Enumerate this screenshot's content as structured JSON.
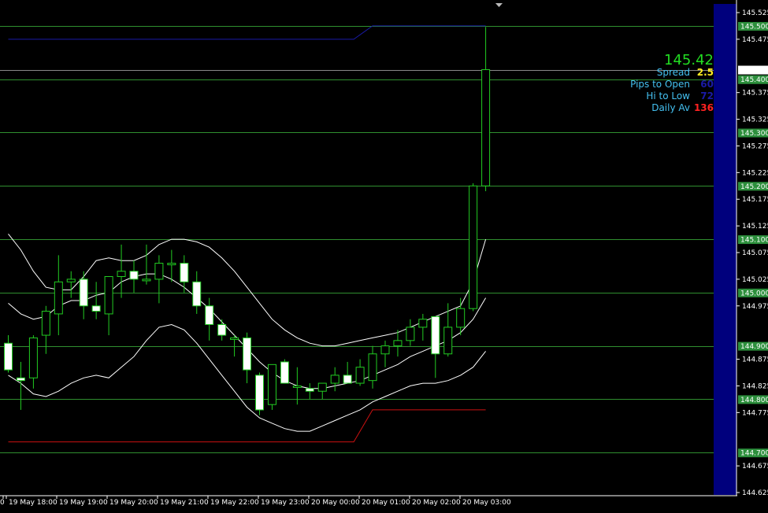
{
  "colors": {
    "background": "#000000",
    "level_line": "#2f8f2f",
    "candle_up_fill": "#000000",
    "candle_down_fill": "#ffffff",
    "candle_wick": "#22cc22",
    "bands": "#ffffff",
    "high_line": "#1a1aa8",
    "low_line": "#cc1111",
    "right_panel": "#00007d",
    "current_price": "#22dd22",
    "label_text": "#44c0f0",
    "spread_value": "#ffee22",
    "pips_value": "#1a1aa8",
    "hilo_value": "#1a1aa8",
    "daily_label": "#44c0f0",
    "daily_value": "#ff2222",
    "level_tag_bg": "#2c8f3c"
  },
  "info_panel": {
    "current_price": "145.42",
    "rows": [
      {
        "label": "Spread",
        "value": "2.5"
      },
      {
        "label": "Pips to Open",
        "value": "60"
      },
      {
        "label": "Hi to Low",
        "value": "72"
      },
      {
        "label": "Daily Av",
        "value": "136"
      }
    ]
  },
  "chart_data": {
    "type": "candlestick",
    "ylim": [
      144.625,
      145.525
    ],
    "price_axis_ticks": [
      "145.525",
      "145.475",
      "145.375",
      "145.325",
      "145.275",
      "145.225",
      "145.175",
      "145.125",
      "145.075",
      "145.025",
      "144.975",
      "144.875",
      "144.825",
      "144.775",
      "144.675",
      "144.625"
    ],
    "level_lines": [
      "145.500",
      "145.400",
      "145.300",
      "145.200",
      "145.100",
      "145.000",
      "144.900",
      "144.800",
      "144.700"
    ],
    "current_price_tag": "145.418",
    "time_labels": [
      "18:00",
      "19 May 18:00",
      "19 May 19:00",
      "19 May 20:00",
      "19 May 21:00",
      "19 May 22:00",
      "19 May 23:00",
      "20 May 00:00",
      "20 May 01:00",
      "20 May 02:00",
      "20 May 03:00"
    ],
    "time_label_first_fragment": "0",
    "candles": [
      {
        "o": 144.905,
        "h": 144.92,
        "l": 144.85,
        "c": 144.855
      },
      {
        "o": 144.84,
        "h": 144.87,
        "l": 144.78,
        "c": 144.835
      },
      {
        "o": 144.84,
        "h": 144.92,
        "l": 144.82,
        "c": 144.915
      },
      {
        "o": 144.92,
        "h": 144.975,
        "l": 144.885,
        "c": 144.965
      },
      {
        "o": 144.96,
        "h": 145.07,
        "l": 144.92,
        "c": 145.02
      },
      {
        "o": 145.02,
        "h": 145.04,
        "l": 144.99,
        "c": 145.025
      },
      {
        "o": 145.025,
        "h": 145.04,
        "l": 144.95,
        "c": 144.975
      },
      {
        "o": 144.975,
        "h": 145.02,
        "l": 144.95,
        "c": 144.965
      },
      {
        "o": 144.96,
        "h": 145.03,
        "l": 144.92,
        "c": 145.03
      },
      {
        "o": 145.03,
        "h": 145.09,
        "l": 144.99,
        "c": 145.04
      },
      {
        "o": 145.04,
        "h": 145.06,
        "l": 145.0,
        "c": 145.025
      },
      {
        "o": 145.025,
        "h": 145.09,
        "l": 145.015,
        "c": 145.025
      },
      {
        "o": 145.025,
        "h": 145.07,
        "l": 144.98,
        "c": 145.055
      },
      {
        "o": 145.055,
        "h": 145.08,
        "l": 145.02,
        "c": 145.055
      },
      {
        "o": 145.055,
        "h": 145.07,
        "l": 145.0,
        "c": 145.02
      },
      {
        "o": 145.02,
        "h": 145.04,
        "l": 144.96,
        "c": 144.975
      },
      {
        "o": 144.975,
        "h": 144.99,
        "l": 144.91,
        "c": 144.94
      },
      {
        "o": 144.94,
        "h": 144.95,
        "l": 144.91,
        "c": 144.92
      },
      {
        "o": 144.915,
        "h": 144.92,
        "l": 144.88,
        "c": 144.915
      },
      {
        "o": 144.915,
        "h": 144.925,
        "l": 144.83,
        "c": 144.855
      },
      {
        "o": 144.845,
        "h": 144.85,
        "l": 144.77,
        "c": 144.78
      },
      {
        "o": 144.79,
        "h": 144.86,
        "l": 144.78,
        "c": 144.865
      },
      {
        "o": 144.87,
        "h": 144.875,
        "l": 144.835,
        "c": 144.83
      },
      {
        "o": 144.825,
        "h": 144.86,
        "l": 144.79,
        "c": 144.825
      },
      {
        "o": 144.82,
        "h": 144.83,
        "l": 144.8,
        "c": 144.815
      },
      {
        "o": 144.815,
        "h": 144.83,
        "l": 144.8,
        "c": 144.83
      },
      {
        "o": 144.83,
        "h": 144.86,
        "l": 144.815,
        "c": 144.845
      },
      {
        "o": 144.845,
        "h": 144.87,
        "l": 144.83,
        "c": 144.83
      },
      {
        "o": 144.83,
        "h": 144.875,
        "l": 144.825,
        "c": 144.86
      },
      {
        "o": 144.835,
        "h": 144.9,
        "l": 144.82,
        "c": 144.885
      },
      {
        "o": 144.885,
        "h": 144.91,
        "l": 144.86,
        "c": 144.9
      },
      {
        "o": 144.9,
        "h": 144.93,
        "l": 144.88,
        "c": 144.91
      },
      {
        "o": 144.91,
        "h": 144.95,
        "l": 144.9,
        "c": 144.935
      },
      {
        "o": 144.935,
        "h": 144.96,
        "l": 144.91,
        "c": 144.95
      },
      {
        "o": 144.955,
        "h": 144.95,
        "l": 144.84,
        "c": 144.885
      },
      {
        "o": 144.885,
        "h": 144.98,
        "l": 144.88,
        "c": 144.935
      },
      {
        "o": 144.935,
        "h": 144.99,
        "l": 144.92,
        "c": 144.97
      },
      {
        "o": 144.97,
        "h": 145.205,
        "l": 144.965,
        "c": 145.2
      },
      {
        "o": 145.2,
        "h": 145.498,
        "l": 145.19,
        "c": 145.418
      }
    ],
    "upper_band": [
      145.11,
      145.08,
      145.04,
      145.01,
      145.005,
      145.005,
      145.03,
      145.06,
      145.065,
      145.06,
      145.06,
      145.07,
      145.09,
      145.1,
      145.1,
      145.095,
      145.085,
      145.065,
      145.04,
      145.01,
      144.98,
      144.95,
      144.93,
      144.915,
      144.905,
      144.9,
      144.9,
      144.905,
      144.91,
      144.915,
      144.92,
      144.925,
      144.935,
      144.945,
      144.955,
      144.965,
      144.975,
      145.02,
      145.1
    ],
    "middle_band": [
      144.98,
      144.96,
      144.95,
      144.955,
      144.975,
      144.985,
      144.985,
      144.995,
      145.0,
      145.02,
      145.03,
      145.035,
      145.035,
      145.025,
      145.01,
      144.99,
      144.97,
      144.945,
      144.92,
      144.895,
      144.87,
      144.85,
      144.835,
      144.825,
      144.82,
      144.82,
      144.825,
      144.83,
      144.835,
      144.845,
      144.855,
      144.865,
      144.88,
      144.89,
      144.9,
      144.91,
      144.925,
      144.95,
      144.99
    ],
    "lower_band": [
      144.845,
      144.83,
      144.81,
      144.805,
      144.815,
      144.83,
      144.84,
      144.845,
      144.84,
      144.86,
      144.88,
      144.91,
      144.935,
      144.94,
      144.93,
      144.905,
      144.875,
      144.845,
      144.815,
      144.785,
      144.765,
      144.755,
      144.745,
      144.74,
      144.74,
      144.75,
      144.76,
      144.77,
      144.78,
      144.795,
      144.805,
      144.815,
      144.825,
      144.83,
      144.83,
      144.835,
      144.845,
      144.86,
      144.89
    ],
    "day_high_line": [
      {
        "x": 0,
        "y": 145.475
      },
      {
        "x": 27.5,
        "y": 145.475
      },
      {
        "x": 29,
        "y": 145.5
      },
      {
        "x": 38,
        "y": 145.5
      }
    ],
    "day_low_line": [
      {
        "x": 0,
        "y": 144.72
      },
      {
        "x": 27.5,
        "y": 144.72
      },
      {
        "x": 29,
        "y": 144.78
      },
      {
        "x": 38,
        "y": 144.78
      }
    ]
  }
}
